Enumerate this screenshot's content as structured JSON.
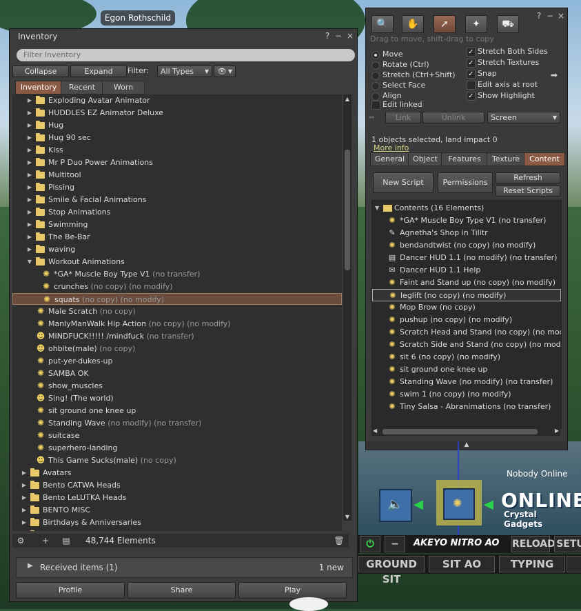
{
  "avatar_name": "Egon Rothschild",
  "inventory": {
    "title": "Inventory",
    "help_icon": "?",
    "close_icon": "×",
    "filter_placeholder": "Filter Inventory",
    "collapse": "Collapse",
    "expand": "Expand",
    "filter_label": "Filter:",
    "filter_value": "All Types",
    "tabs": [
      "Inventory",
      "Recent",
      "Worn"
    ],
    "active_tab": "Inventory",
    "rows": [
      {
        "type": "folder",
        "depth": 1,
        "expanded": false,
        "name": "Exploding Avatar Animator",
        "meta": ""
      },
      {
        "type": "folder",
        "depth": 1,
        "expanded": false,
        "name": "HUDDLES EZ Animator Deluxe",
        "meta": ""
      },
      {
        "type": "folder",
        "depth": 1,
        "expanded": false,
        "name": "Hug",
        "meta": ""
      },
      {
        "type": "folder",
        "depth": 1,
        "expanded": false,
        "name": "Hug 90 sec",
        "meta": ""
      },
      {
        "type": "folder",
        "depth": 1,
        "expanded": false,
        "name": "Kiss",
        "meta": ""
      },
      {
        "type": "folder",
        "depth": 1,
        "expanded": false,
        "name": "Mr P Duo Power Animations",
        "meta": ""
      },
      {
        "type": "folder",
        "depth": 1,
        "expanded": false,
        "name": "Multitool",
        "meta": ""
      },
      {
        "type": "folder",
        "depth": 1,
        "expanded": false,
        "name": "Pissing",
        "meta": ""
      },
      {
        "type": "folder",
        "depth": 1,
        "expanded": false,
        "name": "Smile & Facial Animations",
        "meta": ""
      },
      {
        "type": "folder",
        "depth": 1,
        "expanded": false,
        "name": "Stop Animations",
        "meta": ""
      },
      {
        "type": "folder",
        "depth": 1,
        "expanded": false,
        "name": "Swimming",
        "meta": ""
      },
      {
        "type": "folder",
        "depth": 1,
        "expanded": false,
        "name": "The Be-Bar",
        "meta": ""
      },
      {
        "type": "folder",
        "depth": 1,
        "expanded": false,
        "name": "waving",
        "meta": ""
      },
      {
        "type": "folder",
        "depth": 1,
        "expanded": true,
        "name": "Workout Animations",
        "meta": ""
      },
      {
        "type": "anim",
        "depth": 2,
        "name": "*GA* Muscle Boy Type V1",
        "meta": "(no transfer)"
      },
      {
        "type": "anim",
        "depth": 2,
        "name": "crunches",
        "meta": "(no copy) (no modify)"
      },
      {
        "type": "anim",
        "depth": 2,
        "name": "squats",
        "meta": "(no copy) (no modify)",
        "selected": true
      },
      {
        "type": "anim",
        "depth": 1,
        "name": "Male Scratch",
        "meta": "(no copy)"
      },
      {
        "type": "anim",
        "depth": 1,
        "name": "ManlyManWalk Hip Action",
        "meta": "(no copy) (no modify)"
      },
      {
        "type": "gesture",
        "depth": 1,
        "name": "MINDFUCK!!!!! /mindfuck",
        "meta": "(no transfer)"
      },
      {
        "type": "gesture",
        "depth": 1,
        "name": "ohbite(male)",
        "meta": "(no copy)"
      },
      {
        "type": "anim",
        "depth": 1,
        "name": "put-yer-dukes-up",
        "meta": ""
      },
      {
        "type": "anim",
        "depth": 1,
        "name": "SAMBA OK",
        "meta": ""
      },
      {
        "type": "anim",
        "depth": 1,
        "name": "show_muscles",
        "meta": ""
      },
      {
        "type": "gesture",
        "depth": 1,
        "name": "Sing! (The world)",
        "meta": ""
      },
      {
        "type": "anim",
        "depth": 1,
        "name": "sit ground one knee up",
        "meta": ""
      },
      {
        "type": "anim",
        "depth": 1,
        "name": "Standing Wave",
        "meta": "(no modify) (no transfer)"
      },
      {
        "type": "anim",
        "depth": 1,
        "name": "suitcase",
        "meta": ""
      },
      {
        "type": "anim",
        "depth": 1,
        "name": "superhero-landing",
        "meta": ""
      },
      {
        "type": "gesture",
        "depth": 1,
        "name": "This Game Sucks(male)",
        "meta": "(no copy)"
      },
      {
        "type": "folder",
        "depth": 0,
        "expanded": false,
        "name": "Avatars",
        "meta": ""
      },
      {
        "type": "folder",
        "depth": 0,
        "expanded": false,
        "name": "Bento CATWA Heads",
        "meta": ""
      },
      {
        "type": "folder",
        "depth": 0,
        "expanded": false,
        "name": "Bento LeLUTKA Heads",
        "meta": ""
      },
      {
        "type": "folder",
        "depth": 0,
        "expanded": false,
        "name": "BENTO MISC",
        "meta": ""
      },
      {
        "type": "folder",
        "depth": 0,
        "expanded": false,
        "name": "Birthdays & Anniversaries",
        "meta": ""
      },
      {
        "type": "folder",
        "depth": 0,
        "expanded": false,
        "name": "Body Parts",
        "meta": ""
      }
    ],
    "element_count": "48,744 Elements",
    "received_label": "Received items (1)",
    "received_new": "1 new",
    "profile": "Profile",
    "share": "Share",
    "play": "Play"
  },
  "build": {
    "hint": "Drag to move, shift-drag to copy",
    "modes": [
      {
        "label": "Move",
        "on": true
      },
      {
        "label": "Rotate (Ctrl)",
        "on": false
      },
      {
        "label": "Stretch (Ctrl+Shift)",
        "on": false
      },
      {
        "label": "Select Face",
        "on": false
      },
      {
        "label": "Align",
        "on": false
      }
    ],
    "edit_linked": "Edit linked",
    "options": [
      {
        "label": "Stretch Both Sides",
        "checked": true
      },
      {
        "label": "Stretch Textures",
        "checked": true
      },
      {
        "label": "Snap",
        "checked": true
      },
      {
        "label": "Edit axis at root",
        "checked": false
      },
      {
        "label": "Show Highlight",
        "checked": true
      }
    ],
    "link": "Link",
    "unlink": "Unlink",
    "ruler_value": "Screen",
    "selection_info": "1 objects selected, land impact 0",
    "more_info": "More info",
    "tabs": [
      "General",
      "Object",
      "Features",
      "Texture",
      "Content"
    ],
    "active_tab": "Content",
    "new_script": "New Script",
    "permissions": "Permissions",
    "refresh": "Refresh",
    "reset_scripts": "Reset Scripts",
    "contents_header": "Contents (16 Elements)",
    "contents": [
      {
        "icon": "anim",
        "name": "*GA* Muscle Boy Type V1 (no transfer)"
      },
      {
        "icon": "landmark",
        "name": "Agnetha's Shop in Tilitr"
      },
      {
        "icon": "anim",
        "name": "bendandtwist (no copy) (no modify)"
      },
      {
        "icon": "script",
        "name": "Dancer HUD 1.1 (no modify) (no transfer)"
      },
      {
        "icon": "notecard",
        "name": "Dancer HUD 1.1 Help"
      },
      {
        "icon": "anim",
        "name": "Faint and Stand up (no copy) (no modify)"
      },
      {
        "icon": "anim",
        "name": "leglift (no copy) (no modify)",
        "selected": true
      },
      {
        "icon": "anim",
        "name": "Mop Brow (no copy)"
      },
      {
        "icon": "anim",
        "name": "pushup (no copy) (no modify)"
      },
      {
        "icon": "anim",
        "name": "Scratch Head and Stand (no copy) (no modify)"
      },
      {
        "icon": "anim",
        "name": "Scratch Side and Stand (no copy) (no modify)"
      },
      {
        "icon": "anim",
        "name": "sit 6 (no copy) (no modify)"
      },
      {
        "icon": "anim",
        "name": "sit ground one knee up"
      },
      {
        "icon": "anim",
        "name": "Standing Wave (no modify) (no transfer)"
      },
      {
        "icon": "anim",
        "name": "swim 1 (no copy) (no modify)"
      },
      {
        "icon": "anim",
        "name": "Tiny Salsa - Abranimations (no transfer)"
      }
    ]
  },
  "hud": {
    "nobody_online": "Nobody Online",
    "online": "ONLINE",
    "crystal": "Crystal Gadgets",
    "ao_brand": "AKEYO NITRO AO",
    "reload": "RELOAD",
    "setup": "SETU",
    "ground_sit": "GROUND SIT",
    "sit_ao": "SIT AO",
    "typing": "TYPING"
  }
}
